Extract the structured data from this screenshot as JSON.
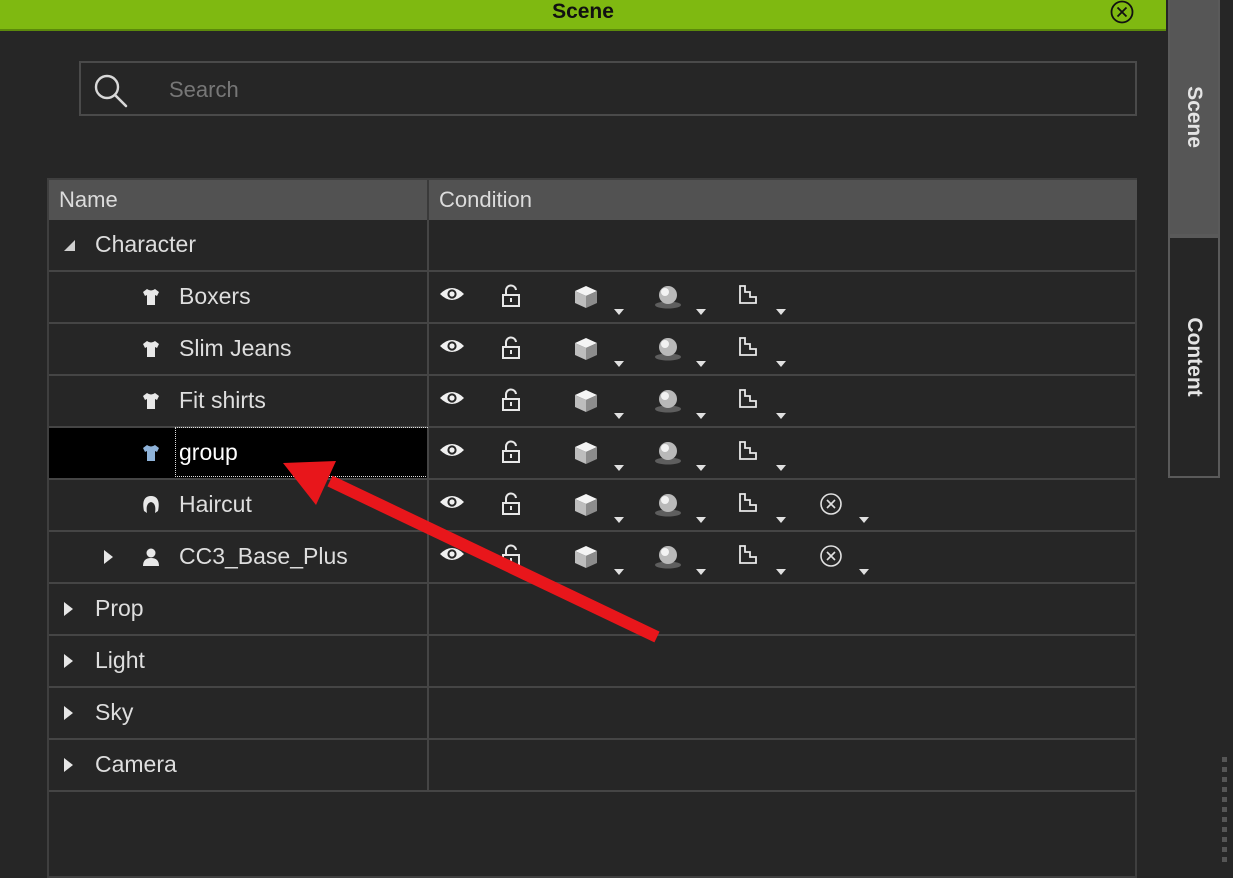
{
  "titlebar": {
    "title": "Scene",
    "close_icon": "close-circle-icon",
    "accent": "#7fb911"
  },
  "search": {
    "placeholder": "Search",
    "value": ""
  },
  "tree": {
    "columns": [
      "Name",
      "Condition"
    ],
    "rows": [
      {
        "label": "Character",
        "type": "category",
        "expanded": true,
        "conditions": []
      },
      {
        "label": "Boxers",
        "type": "cloth",
        "conditions": [
          "eye-icon",
          "unlock-icon",
          "cube-icon",
          "sphere-icon",
          "step-icon"
        ]
      },
      {
        "label": "Slim Jeans",
        "type": "cloth",
        "conditions": [
          "eye-icon",
          "unlock-icon",
          "cube-icon",
          "sphere-icon",
          "step-icon"
        ]
      },
      {
        "label": "Fit shirts",
        "type": "cloth",
        "conditions": [
          "eye-icon",
          "unlock-icon",
          "cube-icon",
          "sphere-icon",
          "step-icon"
        ]
      },
      {
        "label": "group",
        "type": "cloth",
        "selected": true,
        "editing": true,
        "conditions": [
          "eye-icon",
          "unlock-icon",
          "cube-icon",
          "sphere-icon",
          "step-icon"
        ]
      },
      {
        "label": "Haircut",
        "type": "hair",
        "conditions": [
          "eye-icon",
          "unlock-icon",
          "cube-icon",
          "sphere-icon",
          "step-icon",
          "x-circle-icon"
        ]
      },
      {
        "label": "CC3_Base_Plus",
        "type": "avatar",
        "expanded": false,
        "conditions": [
          "eye-icon",
          "unlock-icon",
          "cube-icon",
          "sphere-icon",
          "step-icon",
          "x-circle-icon"
        ]
      },
      {
        "label": "Prop",
        "type": "category",
        "expanded": false,
        "conditions": []
      },
      {
        "label": "Light",
        "type": "category",
        "expanded": false,
        "conditions": []
      },
      {
        "label": "Sky",
        "type": "category",
        "expanded": false,
        "conditions": []
      },
      {
        "label": "Camera",
        "type": "category",
        "expanded": false,
        "conditions": []
      }
    ]
  },
  "side_tabs": [
    "Scene",
    "Content"
  ],
  "annotation": {
    "type": "red-arrow",
    "points_to": "group",
    "color": "#e8161b"
  }
}
